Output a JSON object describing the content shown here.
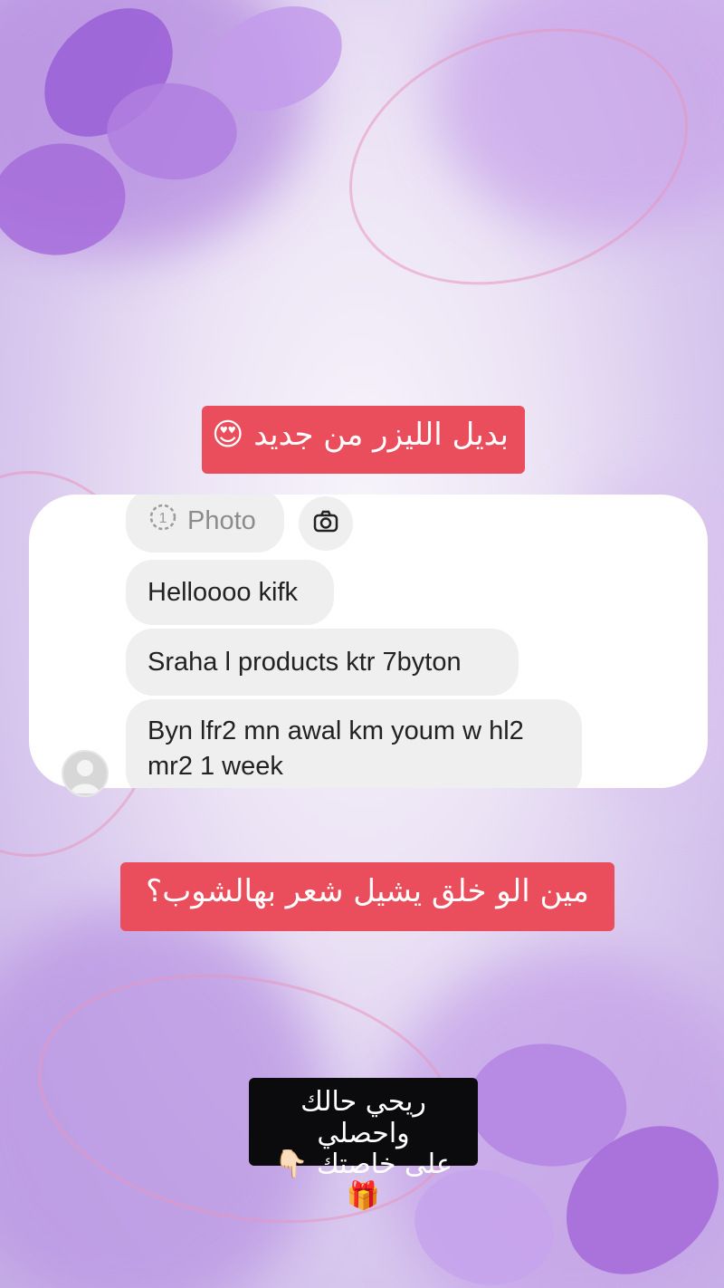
{
  "banners": {
    "top": "بديل الليزر من جديد 😍",
    "middle": "مين الو خلق يشيل شعر بهالشوب؟",
    "bottom_line1": "ريحي حالك واحصلي",
    "bottom_line2": "على خاصتك 👇🏻🎁"
  },
  "chat": {
    "photo_label": "Photo",
    "photo_icon": "view-once-icon",
    "camera_icon": "camera-icon",
    "avatar_icon": "default-avatar-icon",
    "messages": [
      "Helloooo kifk",
      "Sraha l products ktr 7byton",
      "Byn lfr2 mn awal km youm w hl2 mr2 1 week"
    ]
  },
  "colors": {
    "banner_red": "#ea4d5b",
    "banner_black": "#0b0b0d",
    "bubble_gray": "#efefef"
  }
}
